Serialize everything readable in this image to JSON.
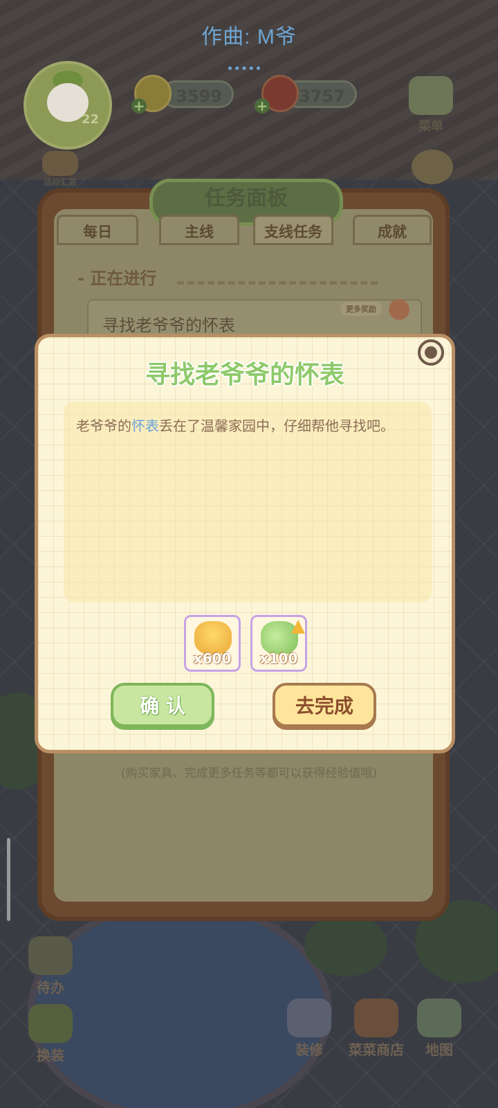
{
  "music_credit": "作曲: M爷",
  "hud": {
    "level": "22",
    "coins": "3599",
    "meat": "3757",
    "menu_label": "菜单",
    "events_label": "活动汇总"
  },
  "quest_panel": {
    "title": "任务面板",
    "tabs": [
      {
        "label": "每日"
      },
      {
        "label": "主线"
      },
      {
        "label": "支线任务",
        "active": true
      },
      {
        "label": "成就"
      }
    ],
    "section_heading": "- 正在进行",
    "current_task": "寻找老爷爷的怀表",
    "more_rewards_badge": "更多奖励",
    "footer_note": "(购买家具、完成更多任务等都可以获得经验值哦)"
  },
  "dialog": {
    "title": "寻找老爷爷的怀表",
    "desc_before": "老爷爷的",
    "desc_highlight": "怀表",
    "desc_after": "丢在了温馨家园中，仔细帮他寻找吧。",
    "rewards": [
      {
        "icon": "gold-coins-icon",
        "count": "x600"
      },
      {
        "icon": "exp-leaf-icon",
        "count": "x100"
      }
    ],
    "confirm_label": "确 认",
    "go_label": "去完成"
  },
  "bottom_nav": {
    "todo": "待办",
    "dress": "换装",
    "decorate": "装修",
    "shop": "菜菜商店",
    "map": "地图"
  },
  "colors": {
    "dialog_bg": "#fcf5d8",
    "title_green": "#8ec96a",
    "highlight_blue": "#6aa3d6",
    "confirm_green": "#c8e6a0",
    "go_yellow": "#ffe59b"
  }
}
